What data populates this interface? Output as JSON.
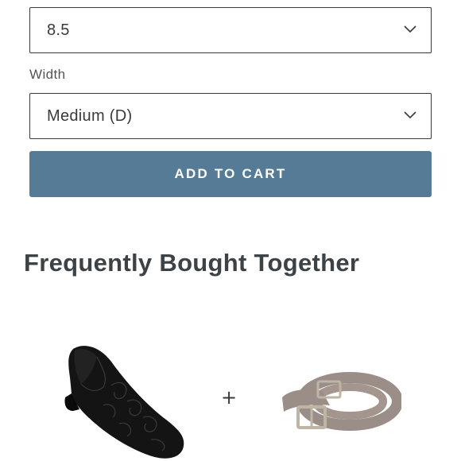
{
  "size_select": {
    "value": "8.5",
    "icon": "chevron-down-icon"
  },
  "width_field": {
    "label": "Width",
    "value": "Medium (D)",
    "icon": "chevron-down-icon"
  },
  "add_to_cart": {
    "label": "ADD TO CART",
    "color": "#557b97"
  },
  "frequently_bought": {
    "title": "Frequently Bought Together",
    "separator": "+",
    "products": [
      {
        "name": "shoe-image"
      },
      {
        "name": "belt-image"
      }
    ]
  }
}
